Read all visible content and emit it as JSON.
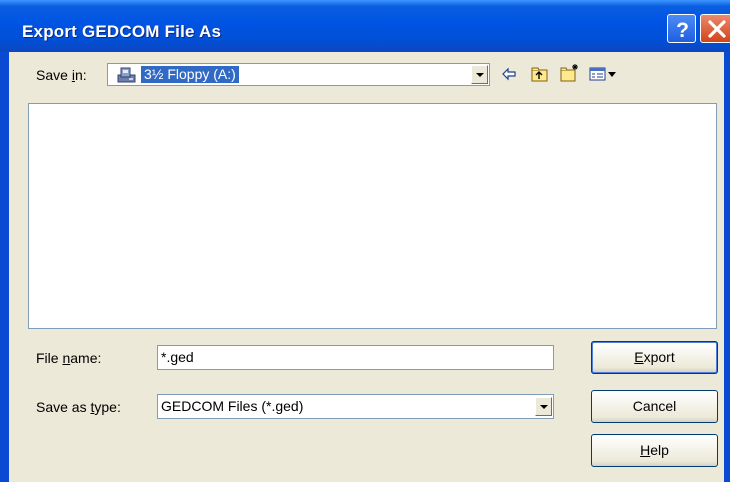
{
  "window": {
    "title": "Export GEDCOM File As"
  },
  "titlebar_buttons": {
    "help": "help-icon",
    "close": "close-icon"
  },
  "save_in": {
    "label_before": "Save ",
    "label_accel": "i",
    "label_after": "n:",
    "value": "3½ Floppy (A:)",
    "drive_icon": "floppy-drive-icon"
  },
  "toolbar": {
    "icons": [
      "back-arrow-icon",
      "up-folder-icon",
      "new-folder-icon",
      "view-menu-icon"
    ]
  },
  "file_name": {
    "label_before": "File ",
    "label_accel": "n",
    "label_after": "ame:",
    "value": "*.ged"
  },
  "save_as_type": {
    "label_before": "Save as ",
    "label_accel": "t",
    "label_after": "ype:",
    "value": "GEDCOM Files (*.ged)"
  },
  "buttons": {
    "export_accel": "E",
    "export_rest": "xport",
    "cancel": "Cancel",
    "help_accel": "H",
    "help_rest": "elp"
  },
  "colors": {
    "title_bar": "#0054e3",
    "selection": "#316ac5",
    "dialog_bg": "#ece9d8"
  }
}
